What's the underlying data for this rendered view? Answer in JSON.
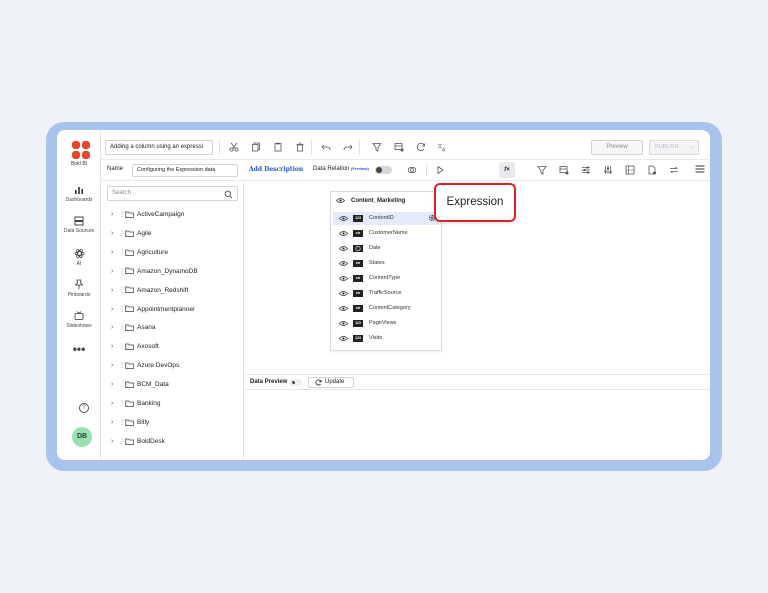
{
  "brand": {
    "name": "Bold BI",
    "logo_color": "#e8452c"
  },
  "nav": [
    {
      "label": "Dashboards",
      "icon": "bar-chart-icon"
    },
    {
      "label": "Data Sources",
      "icon": "database-icon"
    },
    {
      "label": "AI",
      "icon": "ai-atom-icon"
    },
    {
      "label": "Pinboards",
      "icon": "pin-icon"
    },
    {
      "label": "Slideshows",
      "icon": "slideshow-icon"
    }
  ],
  "more_label": "•••",
  "help_label": "?",
  "avatar_initials": "DB",
  "topbar": {
    "title_value": "Adding a column using an expressi",
    "preview_label": "Preview",
    "publish_label": "PUBLISH",
    "publish_caret": "⌄"
  },
  "secbar": {
    "name_label": "Name",
    "name_value": "Configuring the Expression data",
    "add_description": "Add Description",
    "data_relation": "Data Relation",
    "preview_tag": "(Preview)",
    "fx_label": "f×"
  },
  "search": {
    "placeholder": "Search"
  },
  "tree": [
    "ActiveCampaign",
    "Agile",
    "Agriculture",
    "Amazon_DynamoDB",
    "Amazon_Redshift",
    "Appointmentplanner",
    "Asana",
    "Axosoft",
    "Azure DevOps",
    "BCM_Data",
    "Banking",
    "Bitly",
    "BoldDesk"
  ],
  "table_card": {
    "title": "Content_Marketing",
    "close": "×",
    "columns": [
      {
        "type": "123",
        "name": "ContentID"
      },
      {
        "type": "str",
        "name": "CustomerName"
      },
      {
        "type": "date",
        "name": "Date"
      },
      {
        "type": "str",
        "name": "States"
      },
      {
        "type": "str",
        "name": "ContentType"
      },
      {
        "type": "str",
        "name": "TrafficSource"
      },
      {
        "type": "str",
        "name": "ContentCategory"
      },
      {
        "type": "123",
        "name": "PageViews"
      },
      {
        "type": "123",
        "name": "Visits"
      }
    ]
  },
  "data_preview": {
    "label": "Data Preview",
    "update_label": "Update"
  },
  "callout": {
    "text": "Expression",
    "border_color": "#d9262c"
  },
  "colors": {
    "frame": "#a9c4ec",
    "accent_blue": "#1f56c3",
    "selected_row": "#e4ebfb"
  }
}
